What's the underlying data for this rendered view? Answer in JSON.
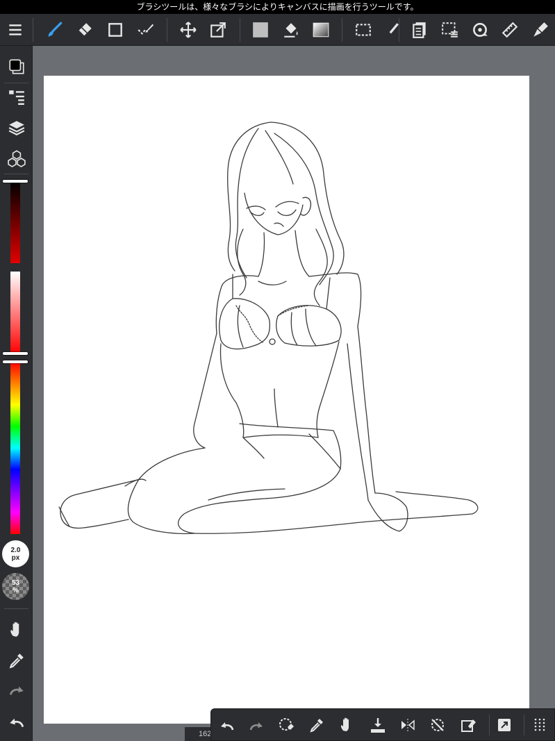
{
  "status_bar": {
    "message": "ブラシツールは、様々なブラシによりキャンバスに描画を行うツールです。"
  },
  "toolbar": {
    "tools": [
      {
        "name": "menu-icon",
        "active": false
      },
      {
        "name": "brush-tool-icon",
        "active": true
      },
      {
        "name": "eraser-tool-icon",
        "active": false
      },
      {
        "name": "shape-tool-icon",
        "active": false
      },
      {
        "name": "lasso-fill-tool-icon",
        "active": false
      },
      {
        "name": "move-tool-icon",
        "active": false
      },
      {
        "name": "transform-tool-icon",
        "active": false
      },
      {
        "name": "fill-color-icon",
        "active": false
      },
      {
        "name": "bucket-tool-icon",
        "active": false
      },
      {
        "name": "gradient-tool-icon",
        "active": false
      },
      {
        "name": "select-tool-icon",
        "active": false
      },
      {
        "name": "select-pen-tool-icon",
        "active": false
      },
      {
        "name": "layer-copy-icon",
        "active": false
      },
      {
        "name": "selection-edit-icon",
        "active": false
      },
      {
        "name": "rotate-view-icon",
        "active": false
      },
      {
        "name": "ruler-icon",
        "active": false
      },
      {
        "name": "filter-icon",
        "active": false
      }
    ]
  },
  "sidebar": {
    "brush_size": {
      "value": "2.0",
      "unit": "px"
    },
    "opacity": {
      "value": "53",
      "unit": "%"
    },
    "color_sliders": {
      "brightness": 0.0,
      "saturation": 1.0,
      "hue": 0.0
    }
  },
  "canvas": {
    "zoom_label": "162"
  },
  "colors": {
    "toolbar_bg": "#2c2d30",
    "workspace_bg": "#6b6e72",
    "accent_active": "#3a9ee8",
    "icon": "#e6e6e6"
  }
}
